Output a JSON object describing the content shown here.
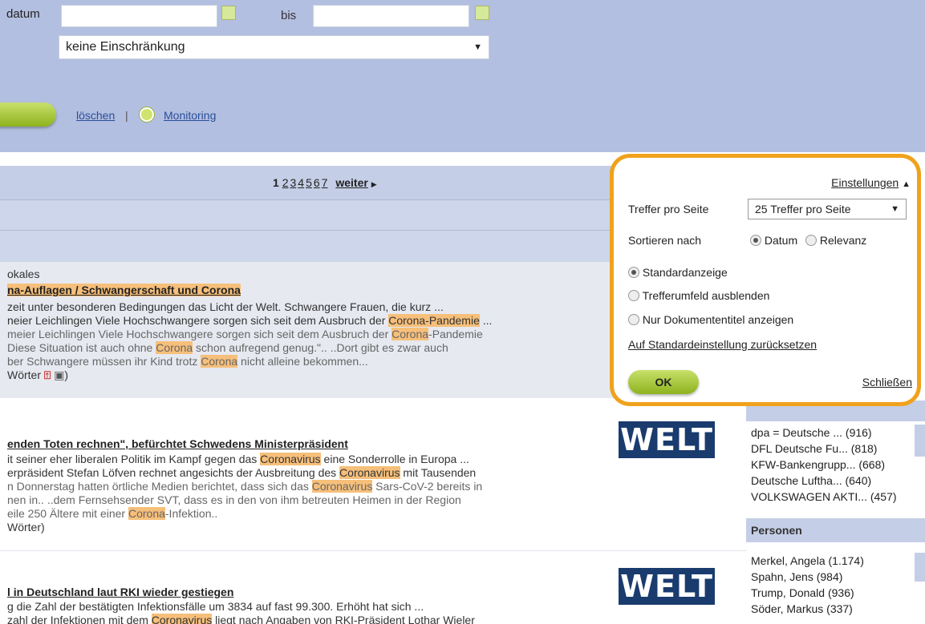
{
  "search": {
    "date_label": "datum",
    "bis_label": "bis",
    "restriction_value": "keine Einschränkung",
    "delete_link": "löschen",
    "separator": "|",
    "monitoring_link": "Monitoring"
  },
  "pagination": {
    "current": "1",
    "pages": [
      "2",
      "3",
      "4",
      "5",
      "6",
      "7"
    ],
    "next_label": "weiter"
  },
  "results": [
    {
      "source_fragment": "okales",
      "title_a": "na-Auflagen / Schwangerschaft und ",
      "title_hl": "Corona",
      "snippets": [
        {
          "parts": [
            {
              "t": "zeit unter besonderen Bedingungen das Licht der Welt. Schwangere Frauen, die kurz ..."
            }
          ]
        },
        {
          "parts": [
            {
              "t": "neier Leichlingen Viele Hochschwangere sorgen sich seit dem Ausbruch der "
            },
            {
              "t": "Corona-Pandemie",
              "hl": true
            },
            {
              "t": " ..."
            }
          ]
        },
        {
          "parts": [
            {
              "t": "meier Leichlingen Viele Hochschwangere sorgen sich seit dem Ausbruch der "
            },
            {
              "t": "Corona",
              "hl": true
            },
            {
              "t": "-Pandemie"
            }
          ]
        },
        {
          "parts": [
            {
              "t": "Diese Situation ist auch ohne "
            },
            {
              "t": "Corona",
              "hl": true
            },
            {
              "t": " schon aufregend genug.\".. ..Dort gibt es zwar auch"
            }
          ]
        },
        {
          "parts": [
            {
              "t": "ber Schwangere müssen ihr Kind trotz "
            },
            {
              "t": "Corona",
              "hl": true
            },
            {
              "t": " nicht alleine bekommen..."
            }
          ]
        }
      ],
      "words": "Wörter"
    },
    {
      "title_a": "enden Toten rechnen\", befürchtet Schwedens Ministerpräsident",
      "snippets": [
        {
          "parts": [
            {
              "t": "it seiner eher liberalen Politik im Kampf gegen das "
            },
            {
              "t": "Coronavirus",
              "hl": true
            },
            {
              "t": " eine Sonderrolle in Europa ..."
            }
          ]
        },
        {
          "parts": [
            {
              "t": "erpräsident Stefan Löfven rechnet angesichts der Ausbreitung des "
            },
            {
              "t": "Coronavirus",
              "hl": true
            },
            {
              "t": " mit Tausenden"
            }
          ]
        },
        {
          "parts": [
            {
              "t": "n Donnerstag hatten örtliche Medien berichtet, dass sich das "
            },
            {
              "t": "Coronavirus",
              "hl": true
            },
            {
              "t": " Sars-CoV-2 bereits in"
            }
          ]
        },
        {
          "parts": [
            {
              "t": "nen in.. ..dem Fernsehsender SVT, dass es in den von ihm betreuten Heimen in der Region"
            }
          ]
        },
        {
          "parts": [
            {
              "t": "eile 250 Ältere mit einer "
            },
            {
              "t": "Corona",
              "hl": true
            },
            {
              "t": "-Infektion.."
            }
          ]
        }
      ],
      "words": "Wörter)",
      "logo": "WELT"
    },
    {
      "title_a": "l in Deutschland laut RKI wieder gestiegen",
      "snippets": [
        {
          "parts": [
            {
              "t": "g die Zahl der bestätigten Infektionsfälle um 3834 auf fast 99.300. Erhöht hat sich ..."
            }
          ]
        },
        {
          "parts": [
            {
              "t": "zahl der Infektionen mit dem "
            },
            {
              "t": "Coronavirus",
              "hl": true
            },
            {
              "t": " liegt nach Angaben von RKI-Präsident Lothar Wieler"
            }
          ]
        }
      ],
      "logo": "WELT"
    }
  ],
  "facets": {
    "companies": [
      "dpa = Deutsche ... (916)",
      "DFL Deutsche Fu... (818)",
      "KFW-Bankengrupp... (668)",
      "Deutsche Luftha... (640)",
      "VOLKSWAGEN AKTI... (457)"
    ],
    "persons_heading": "Personen",
    "persons": [
      "Merkel, Angela (1.174)",
      "Spahn, Jens (984)",
      "Trump, Donald (936)",
      "Söder, Markus (337)"
    ]
  },
  "settings": {
    "header_link": "Einstellungen",
    "per_page_label": "Treffer pro Seite",
    "per_page_value": "25 Treffer pro Seite",
    "sort_label": "Sortieren nach",
    "sort_date": "Datum",
    "sort_relevance": "Relevanz",
    "view_standard": "Standardanzeige",
    "view_hide_context": "Trefferumfeld ausblenden",
    "view_titles_only": "Nur Dokumententitel anzeigen",
    "reset_link": "Auf Standardeinstellung zurücksetzen",
    "ok_label": "OK",
    "close_link": "Schließen"
  },
  "colors": {
    "panel": "#b3bfe0",
    "highlight": "#f6bf7a",
    "popup_border": "#f0a21c",
    "ok_green": "#a6c93a",
    "welt_blue": "#1a3b6e"
  }
}
